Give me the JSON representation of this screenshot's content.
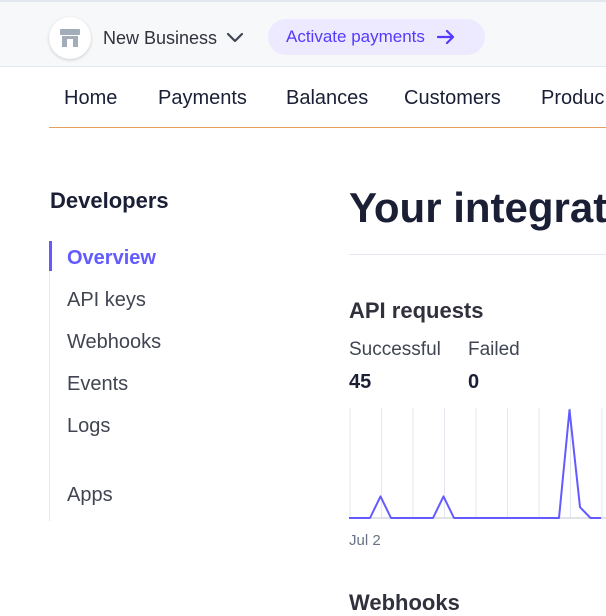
{
  "header": {
    "business_name": "New Business",
    "activate_label": "Activate payments"
  },
  "nav": {
    "items": [
      "Home",
      "Payments",
      "Balances",
      "Customers",
      "Produc"
    ]
  },
  "sidebar": {
    "heading": "Developers",
    "items": [
      {
        "label": "Overview",
        "active": true
      },
      {
        "label": "API keys",
        "active": false
      },
      {
        "label": "Webhooks",
        "active": false
      },
      {
        "label": "Events",
        "active": false
      },
      {
        "label": "Logs",
        "active": false
      },
      {
        "label": "Apps",
        "active": false
      }
    ]
  },
  "main": {
    "title": "Your integrat",
    "api_requests": {
      "title": "API requests",
      "successful_label": "Successful",
      "successful_value": "45",
      "failed_label": "Failed",
      "failed_value": "0",
      "first_date": "Jul 2"
    },
    "webhooks_title": "Webhooks"
  },
  "chart_data": {
    "type": "line",
    "title": "",
    "xlabel": "",
    "ylabel": "",
    "x_tick_labels": [
      "Jul 2"
    ],
    "grid": true,
    "series": [
      {
        "color": "#635bff",
        "values": [
          0,
          0,
          0,
          2,
          0,
          0,
          0,
          0,
          0,
          2,
          0,
          0,
          0,
          0,
          0,
          0,
          0,
          0,
          0,
          0,
          0,
          10,
          1,
          0,
          0
        ]
      }
    ]
  },
  "colors": {
    "accent": "#635bff",
    "nav_underline": "#e6a05c",
    "activate_bg": "#ede9fe"
  }
}
